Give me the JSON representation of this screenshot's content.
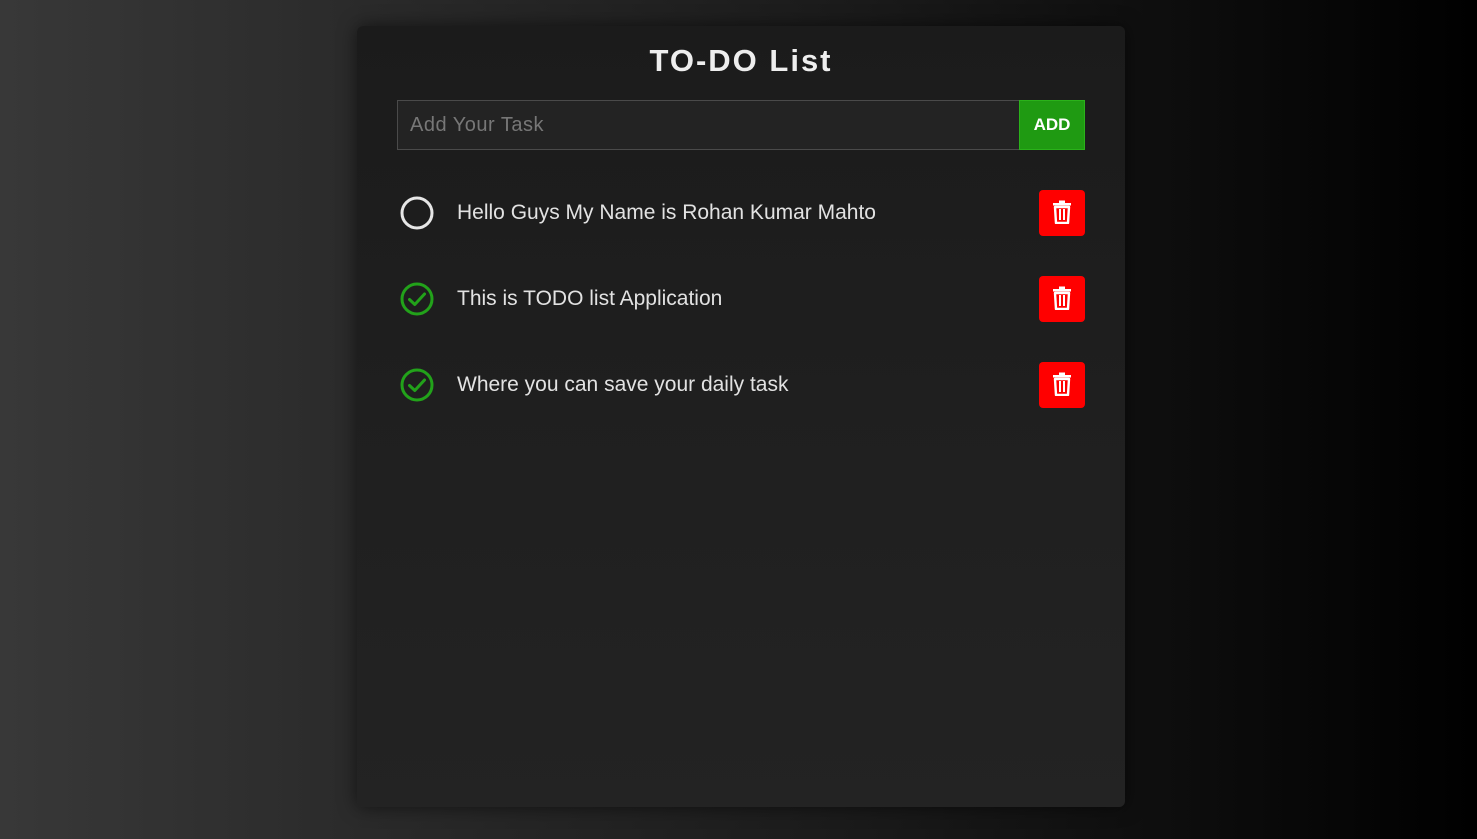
{
  "app": {
    "title": "TO-DO List"
  },
  "input": {
    "placeholder": "Add Your Task",
    "value": "",
    "add_label": "ADD"
  },
  "tasks": [
    {
      "text": "Hello Guys My Name is Rohan Kumar Mahto",
      "done": false
    },
    {
      "text": "This is TODO list Application",
      "done": true
    },
    {
      "text": "Where you can save your daily task",
      "done": true
    }
  ],
  "icons": {
    "unchecked": "circle-icon",
    "checked": "check-circle-icon",
    "delete": "trash-icon"
  },
  "colors": {
    "accent_green": "#1f9a12",
    "delete_red": "#ff0000",
    "check_green": "#22a21a",
    "unchecked_ring": "#e6e6e6"
  }
}
